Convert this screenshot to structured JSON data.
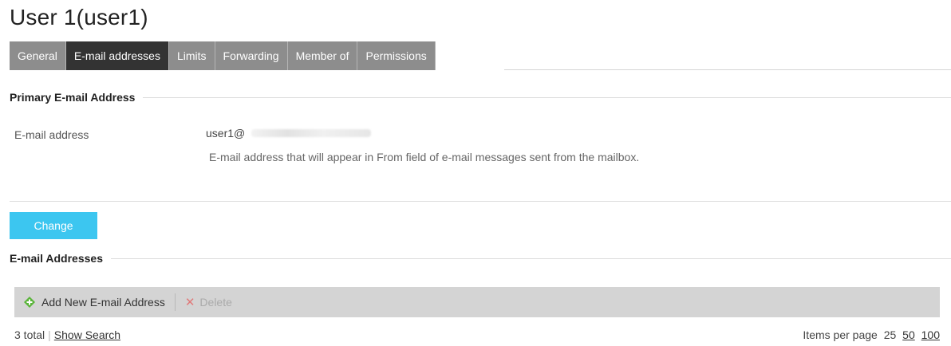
{
  "page": {
    "title": "User 1(user1)"
  },
  "tabs": [
    {
      "label": "General",
      "active": false
    },
    {
      "label": "E-mail addresses",
      "active": true
    },
    {
      "label": "Limits",
      "active": false
    },
    {
      "label": "Forwarding",
      "active": false
    },
    {
      "label": "Member of",
      "active": false
    },
    {
      "label": "Permissions",
      "active": false
    }
  ],
  "primary": {
    "section_title": "Primary E-mail Address",
    "field_label": "E-mail address",
    "value_prefix": "user1@",
    "hint": "E-mail address that will appear in From field of e-mail messages sent from the mailbox."
  },
  "change_button": {
    "label": "Change"
  },
  "addresses": {
    "section_title": "E-mail Addresses",
    "toolbar": {
      "add_label": "Add New E-mail Address",
      "delete_label": "Delete"
    }
  },
  "footer": {
    "total": "3 total",
    "show_search": "Show Search",
    "items_per_page_label": "Items per page",
    "page_sizes": [
      "25",
      "50",
      "100"
    ]
  },
  "colors": {
    "tab_bg": "#8d8d8d",
    "tab_active_bg": "#333333",
    "accent_button": "#3cc6f0",
    "toolbar_bg": "#d4d4d4",
    "add_icon": "#5ab43a",
    "delete_icon": "#e07a7a"
  },
  "icons": {
    "add": "plus-diamond-icon",
    "delete": "x-icon"
  }
}
